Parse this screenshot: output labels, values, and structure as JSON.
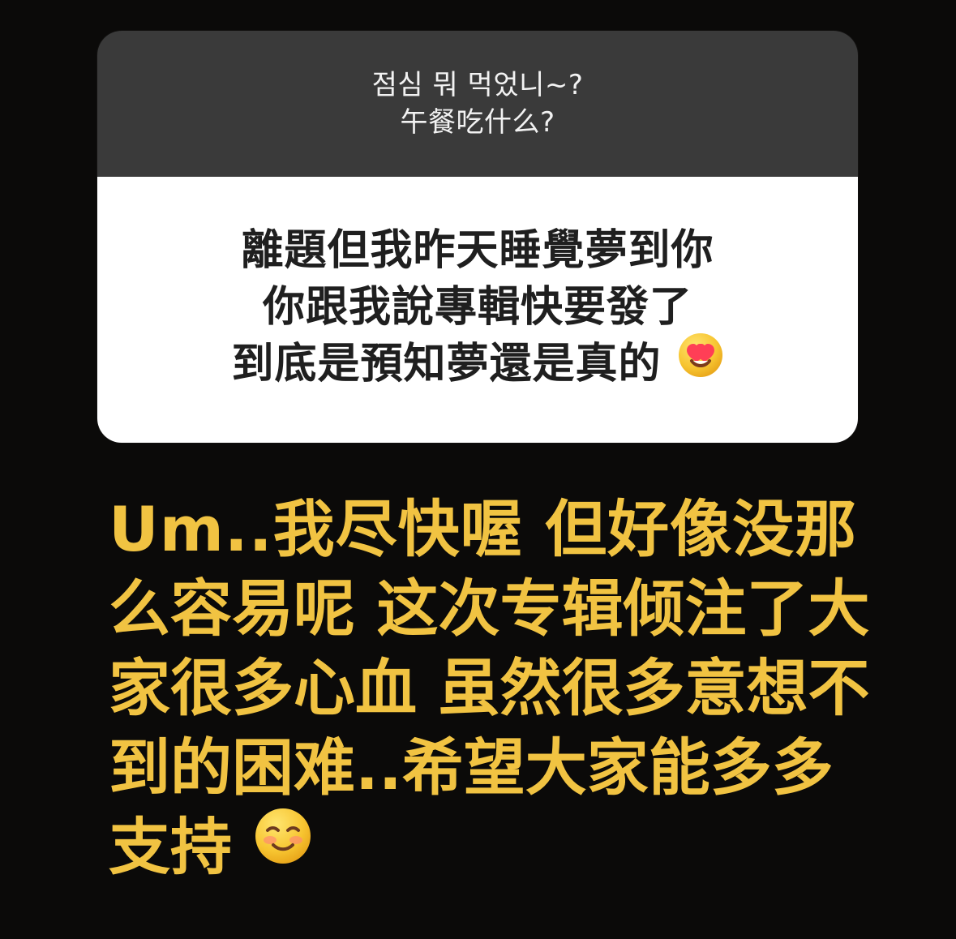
{
  "question_card": {
    "question_lines": [
      "점심 뭐 먹었니~?",
      "午餐吃什么?"
    ],
    "answer_lines": [
      "離題但我昨天睡覺夢到你",
      "你跟我說專輯快要發了",
      "到底是預知夢還是真的"
    ],
    "answer_emoji": "heart-eyes-face-icon"
  },
  "reply_text": {
    "lines": [
      "Um..我尽快喔 但好像没那",
      "么容易呢 这次专辑倾注了大",
      "家很多心血 虽然很多意想不",
      "到的困难..希望大家能多多",
      "支持"
    ],
    "trailing_emoji": "smiling-face-icon"
  },
  "colors": {
    "background": "#0b0a09",
    "card_header": "#3a3a3a",
    "card_body": "#ffffff",
    "reply_text": "#f1c342"
  }
}
